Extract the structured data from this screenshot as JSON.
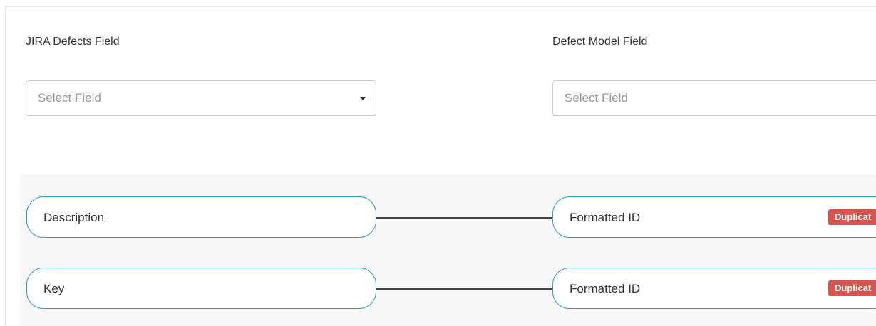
{
  "left_column": {
    "label": "JIRA Defects Field",
    "select_placeholder": "Select Field"
  },
  "right_column": {
    "label": "Defect Model Field",
    "select_placeholder": "Select Field"
  },
  "mappings": [
    {
      "source": "Description",
      "target": "Formatted ID",
      "badge": "Duplicat"
    },
    {
      "source": "Key",
      "target": "Formatted ID",
      "badge": "Duplicat"
    }
  ],
  "colors": {
    "pill_border": "#2a9ac0",
    "connector": "#444444",
    "badge_bg": "#d9534f",
    "mapping_bg": "#f7f7f7"
  }
}
